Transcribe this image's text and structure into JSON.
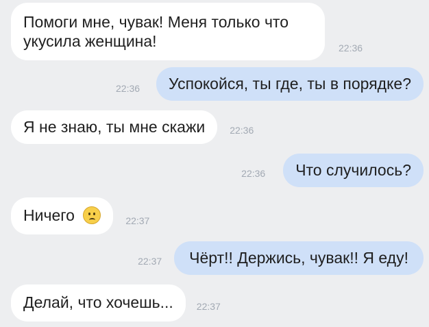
{
  "chat": {
    "messages": [
      {
        "text": "Помоги мне, чувак! Меня только что укусила женщина!",
        "time": "22:36"
      },
      {
        "text": "Успокойся, ты где, ты в порядке?",
        "time": "22:36"
      },
      {
        "text": "Я не знаю, ты мне скажи",
        "time": "22:36"
      },
      {
        "text": "Что случилось?",
        "time": "22:36"
      },
      {
        "text": "Ничего",
        "time": "22:37",
        "icon": "confused-face-emoji"
      },
      {
        "text": "Чёрт!! Держись, чувак!! Я еду!",
        "time": "22:37"
      },
      {
        "text": "Делай, что хочешь...",
        "time": "22:37"
      }
    ]
  }
}
